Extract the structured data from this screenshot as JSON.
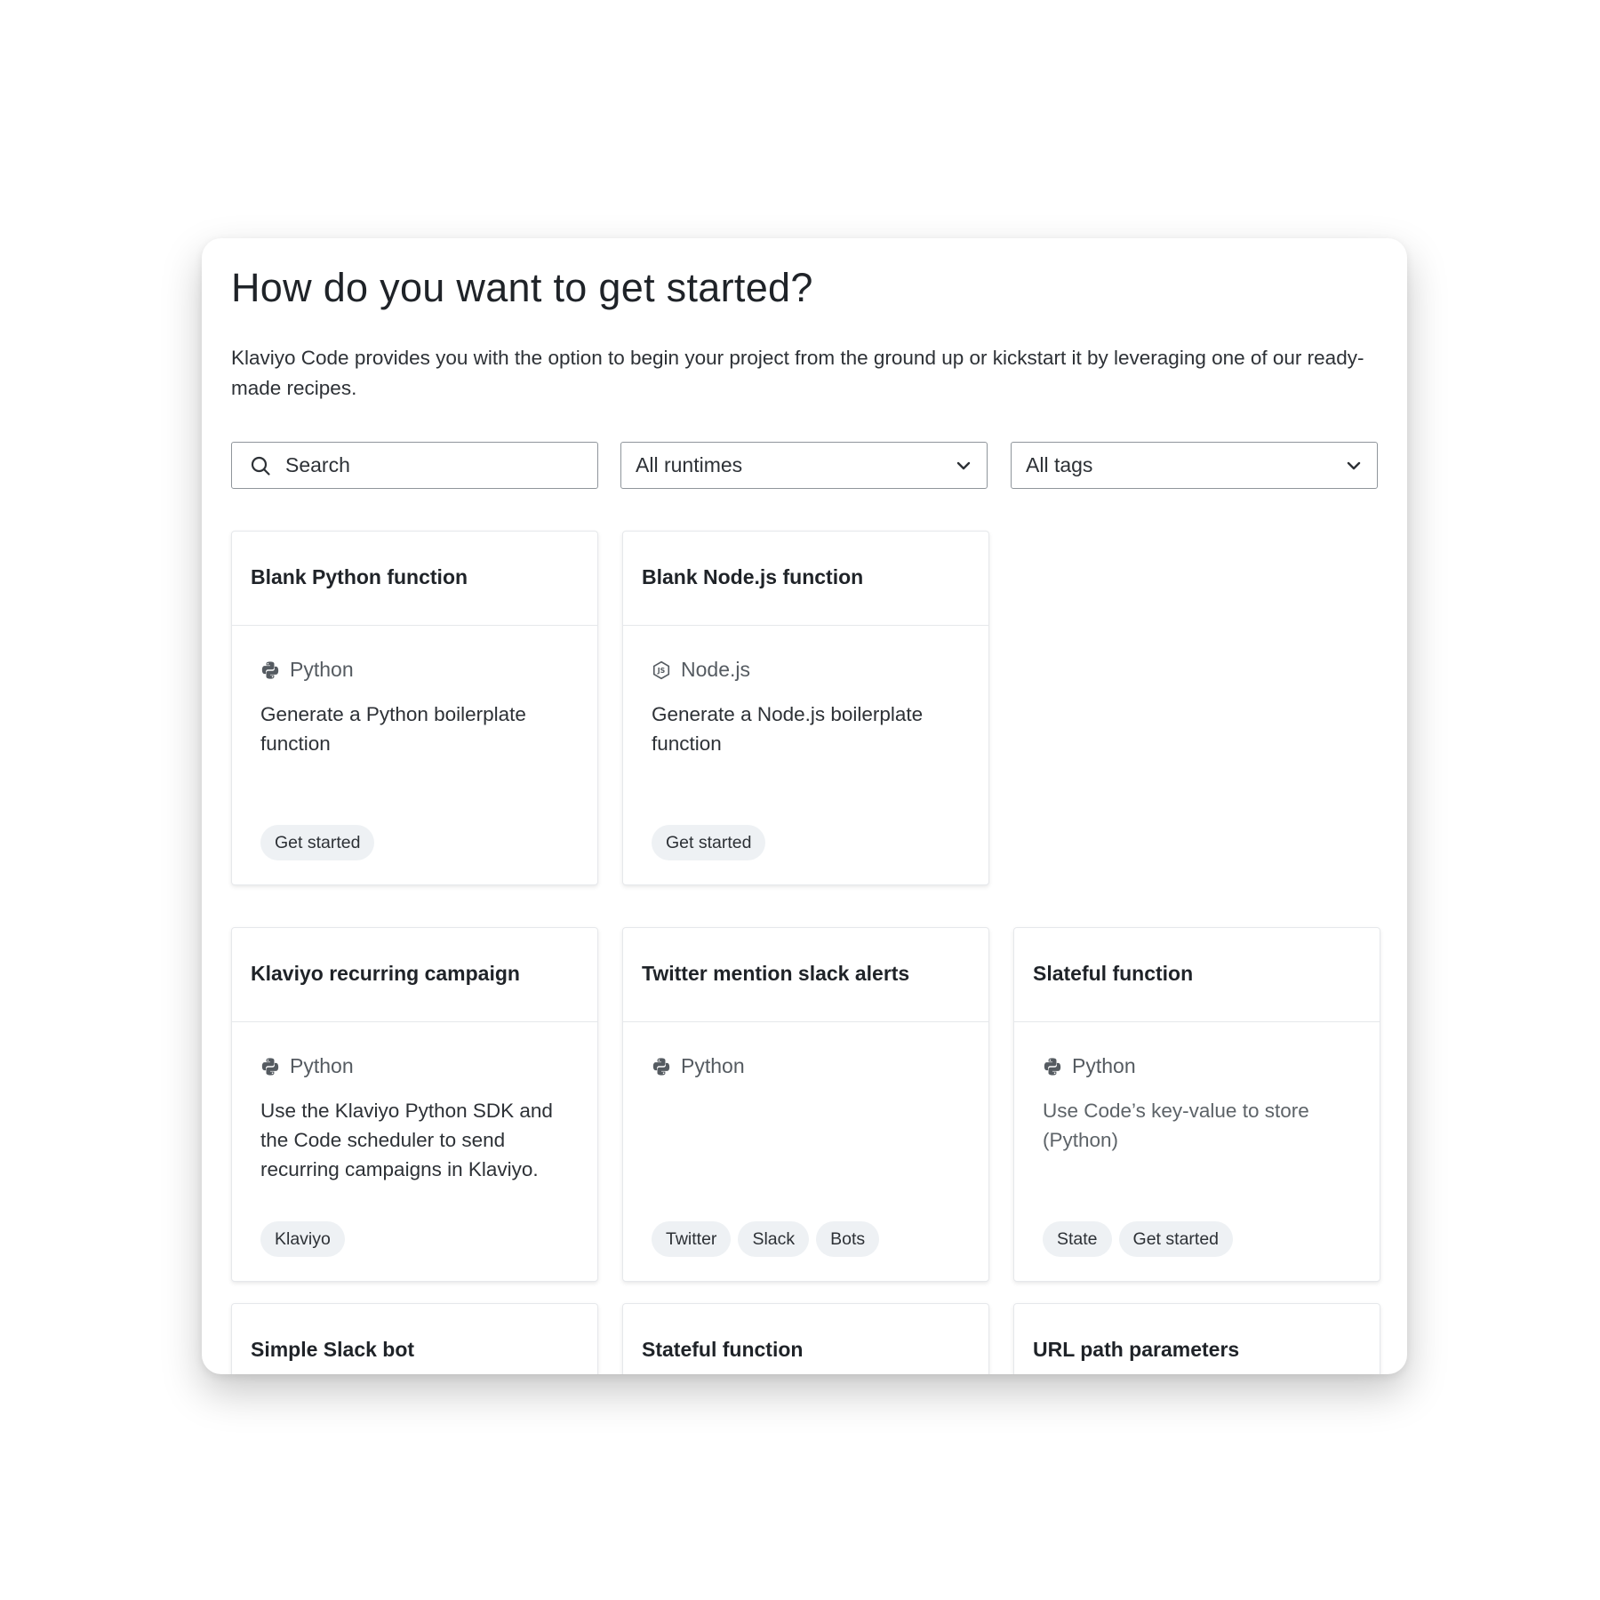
{
  "page": {
    "title": "How do you want to get started?",
    "description": "Klaviyo Code provides you with the option to begin your project from the ground up or kickstart it by leveraging one of our ready-made recipes."
  },
  "filters": {
    "search_placeholder": "Search",
    "runtime_select": "All runtimes",
    "tags_select": "All tags"
  },
  "cards": [
    {
      "title": "Blank Python function",
      "runtime": "Python",
      "runtime_icon": "python-icon",
      "description": "Generate a Python boilerplate function",
      "tags": [
        "Get started"
      ]
    },
    {
      "title": "Blank Node.js function",
      "runtime": "Node.js",
      "runtime_icon": "nodejs-icon",
      "description": "Generate a Node.js boilerplate function",
      "tags": [
        "Get started"
      ]
    },
    {
      "title": "Klaviyo recurring campaign",
      "runtime": "Python",
      "runtime_icon": "python-icon",
      "description": "Use the Klaviyo Python SDK and the Code scheduler to send recurring campaigns in Klaviyo.",
      "tags": [
        "Klaviyo"
      ]
    },
    {
      "title": "Twitter mention slack alerts",
      "runtime": "Python",
      "runtime_icon": "python-icon",
      "description": "",
      "tags": [
        "Twitter",
        "Slack",
        "Bots"
      ]
    },
    {
      "title": "Slateful function",
      "runtime": "Python",
      "runtime_icon": "python-icon",
      "description": "Use Code’s key-value to store (Python)",
      "tags": [
        "State",
        "Get started"
      ]
    },
    {
      "title": "Simple Slack bot"
    },
    {
      "title": "Stateful function"
    },
    {
      "title": "URL path parameters"
    }
  ]
}
